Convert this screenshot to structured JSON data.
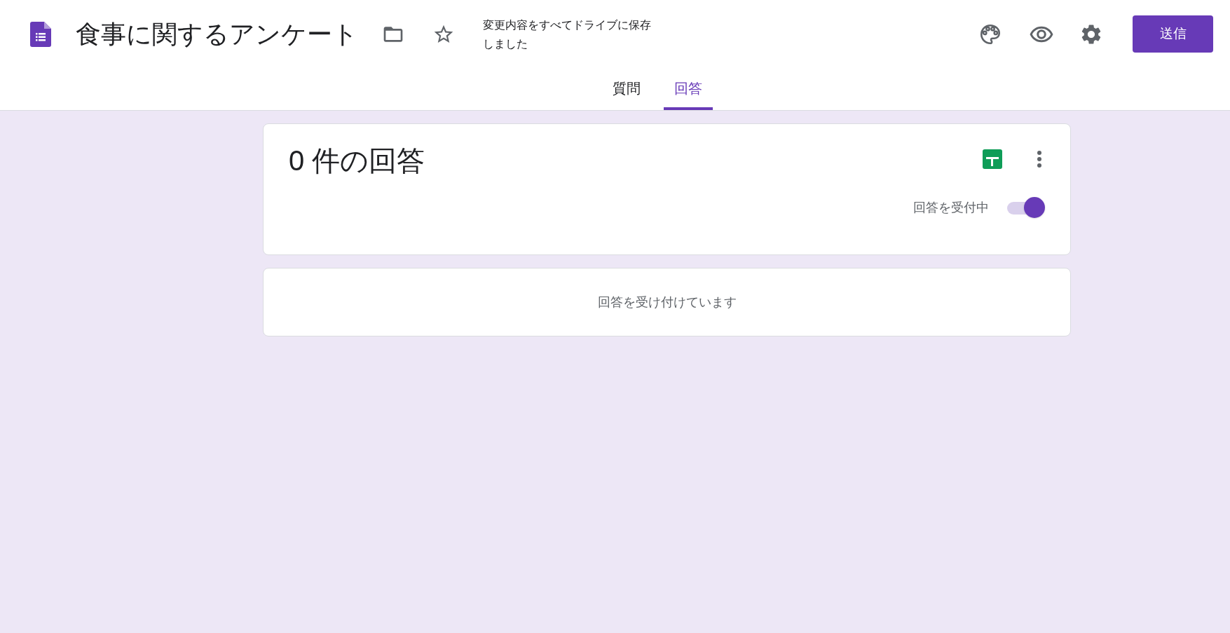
{
  "header": {
    "title": "食事に関するアンケート",
    "save_status": "変更内容をすべてドライブに保存しました",
    "send_button": "送信"
  },
  "tabs": [
    {
      "label": "質問",
      "selected": false
    },
    {
      "label": "回答",
      "selected": true
    }
  ],
  "summary": {
    "title": "0 件の回答",
    "accepting_toggle": {
      "label": "回答を受付中",
      "on": true
    }
  },
  "message": "回答を受け付けています"
}
